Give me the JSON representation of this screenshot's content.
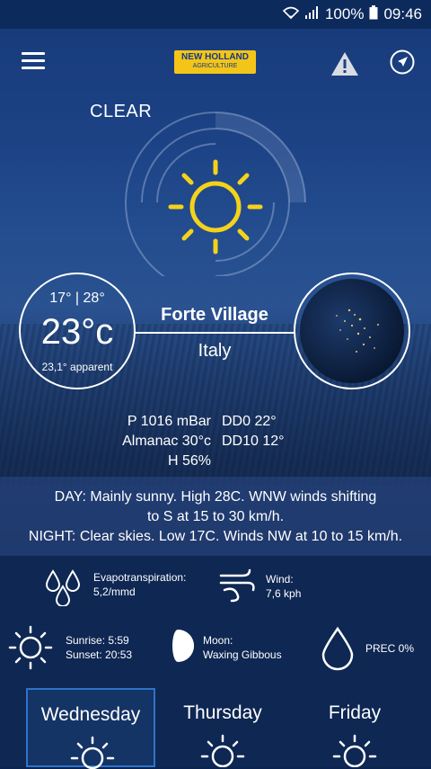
{
  "status_bar": {
    "battery": "100%",
    "time": "09:46"
  },
  "app": {
    "logo_line1": "NEW HOLLAND",
    "logo_line2": "AGRICULTURE"
  },
  "current": {
    "condition": "CLEAR",
    "min_max": "17° | 28°",
    "temperature": "23°c",
    "apparent": "23,1° apparent",
    "location": "Forte Village",
    "country": "Italy"
  },
  "stats": {
    "pressure": "P 1016 mBar",
    "almanac": "Almanac 30°c",
    "humidity": "H 56%",
    "dd0": "DD0 22°",
    "dd10": "DD10 12°"
  },
  "forecast_text": {
    "day_line1": "DAY: Mainly sunny. High 28C. WNW winds shifting",
    "day_line2": "to S at 15 to 30 km/h.",
    "night": "NIGHT: Clear skies. Low 17C. Winds NW at 10 to 15 km/h."
  },
  "details": {
    "evapotranspiration_label": "Evapotranspiration:",
    "evapotranspiration_value": "5,2/mmd",
    "wind_label": "Wind:",
    "wind_value": "7,6 kph",
    "sunrise": "Sunrise: 5:59",
    "sunset": "Sunset: 20:53",
    "moon_label": "Moon:",
    "moon_value": "Waxing Gibbous",
    "precipitation": "PREC 0%"
  },
  "days": [
    {
      "name": "Wednesday"
    },
    {
      "name": "Thursday"
    },
    {
      "name": "Friday"
    }
  ],
  "colors": {
    "accent": "#f3c519",
    "selected_border": "#2f73c8"
  }
}
